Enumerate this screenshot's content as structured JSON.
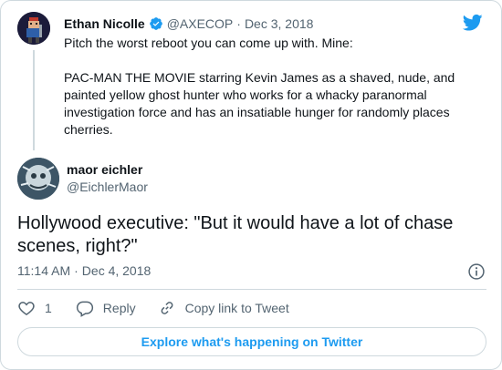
{
  "colors": {
    "accent": "#1d9bf0",
    "text_primary": "#0f1419",
    "text_secondary": "#536471",
    "border": "#cfd9de"
  },
  "icons": {
    "brand": "twitter-bird-icon",
    "verified": "verified-badge-icon",
    "info": "info-icon",
    "like": "heart-icon",
    "reply": "reply-bubble-icon",
    "copy_link": "link-icon"
  },
  "parent_tweet": {
    "author_name": "Ethan Nicolle",
    "author_handle": "@AXECOP",
    "separator": "·",
    "date": "Dec 3, 2018",
    "text": "Pitch the worst reboot you can come up with. Mine:\n\nPAC-MAN THE MOVIE starring Kevin James as a shaved, nude, and painted yellow ghost hunter who works for a whacky paranormal investigation force and has an insatiable hunger for randomly places cherries."
  },
  "tweet": {
    "author_name": "maor eichler",
    "author_handle": "@EichlerMaor",
    "text": "Hollywood executive: \"But it would have a lot of chase scenes, right?\"",
    "time": "11:14 AM",
    "separator": "·",
    "date": "Dec 4, 2018"
  },
  "actions": {
    "like_count": "1",
    "reply_label": "Reply",
    "copy_link_label": "Copy link to Tweet"
  },
  "footer": {
    "explore_label": "Explore what's happening on Twitter"
  }
}
